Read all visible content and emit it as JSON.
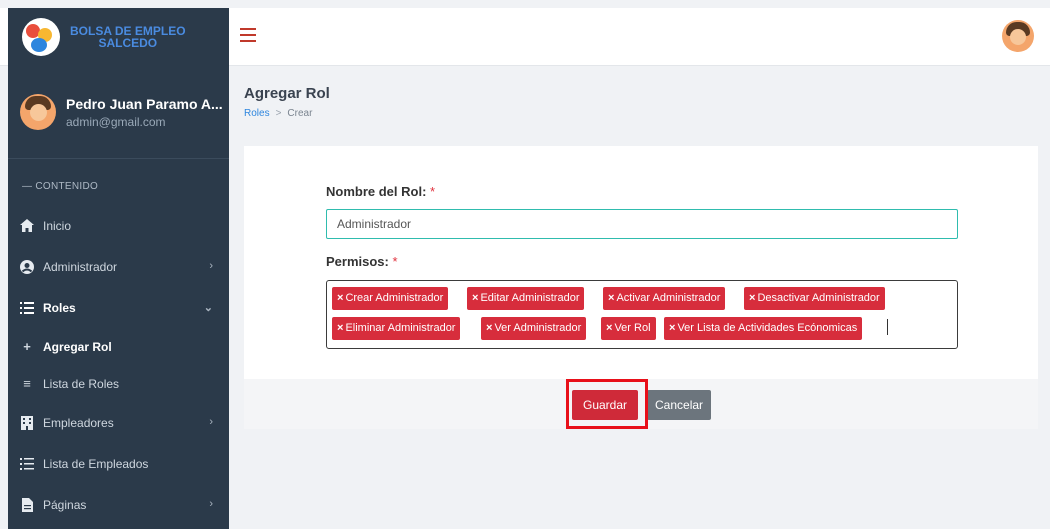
{
  "brand": {
    "line1": "BOLSA DE EMPLEO",
    "line2": "SALCEDO"
  },
  "user": {
    "name": "Pedro Juan Paramo A...",
    "email": "admin@gmail.com"
  },
  "sidebar": {
    "section": "— CONTENIDO",
    "items": [
      {
        "label": "Inicio",
        "icon": "home-icon"
      },
      {
        "label": "Administrador",
        "icon": "user-circle-icon",
        "chevron": "›"
      },
      {
        "label": "Roles",
        "icon": "list-icon",
        "chevron": "⌄"
      },
      {
        "label": "Agregar Rol",
        "icon": "plus-icon"
      },
      {
        "label": "Lista de Roles",
        "icon": "list-lines-icon"
      },
      {
        "label": "Empleadores",
        "icon": "building-icon",
        "chevron": "›"
      },
      {
        "label": "Lista de Empleados",
        "icon": "list-icon"
      },
      {
        "label": "Páginas",
        "icon": "file-icon",
        "chevron": "›"
      }
    ]
  },
  "header": {
    "title": "Agregar Rol",
    "breadcrumb_root": "Roles",
    "breadcrumb_sep": ">",
    "breadcrumb_current": "Crear"
  },
  "form": {
    "name_label": "Nombre del Rol:",
    "required_mark": "*",
    "name_value": "Administrador",
    "permissions_label": "Permisos:",
    "permissions": [
      "Crear Administrador",
      "Editar Administrador",
      "Activar Administrador",
      "Desactivar Administrador",
      "Eliminar Administrador",
      "Ver Administrador",
      "Ver Rol",
      "Ver Lista de Actividades Ecónomicas"
    ],
    "tag_remove": "×"
  },
  "actions": {
    "save": "Guardar",
    "cancel": "Cancelar"
  },
  "colors": {
    "sidebar": "#2b3a4a",
    "accent": "#cf2a39",
    "input_border": "#2fbcae",
    "highlight": "#e8101a"
  }
}
